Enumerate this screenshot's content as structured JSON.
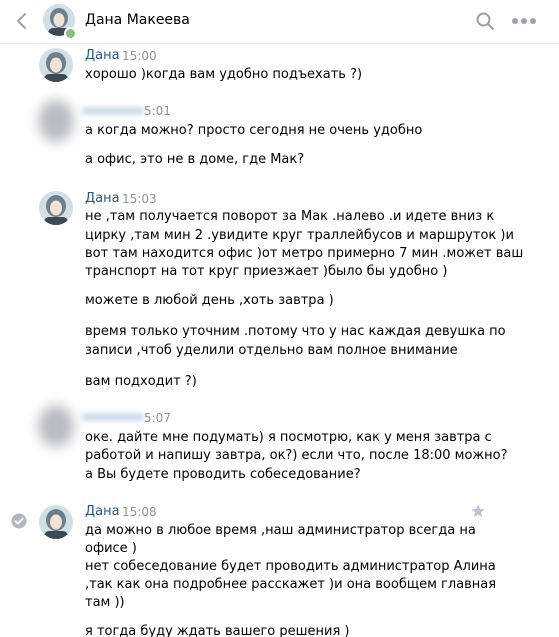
{
  "header": {
    "name": "Дана Макеева",
    "back_icon": "chevron-left-icon",
    "search_icon": "search-icon",
    "more_icon": "more-icon"
  },
  "messages": [
    {
      "author": "Дана",
      "time": "15:00",
      "lines": [
        "хорошо )когда вам удобно подъехать ?)"
      ]
    },
    {
      "author": "",
      "time": "5:01",
      "lines": [
        "а когда можно? просто сегодня не очень удобно",
        "а офис, это не в доме, где Мак?"
      ]
    },
    {
      "author": "Дана",
      "time": "15:03",
      "lines": [
        "не ,там получается поворот за Мак .налево .и идете вниз к",
        "цирку ,там мин 2 .увидите круг траллейбусов и маршруток )и",
        "вот там находится офис )от метро примерно 7 мин .может ваш",
        "транспорт на тот круг приезжает )было бы удобно )",
        "можете в любой день ,хоть завтра )",
        "время только уточним .потому что у нас каждая девушка по",
        "записи ,чтоб уделили отдельно вам полное внимание",
        "вам подходит ?)"
      ]
    },
    {
      "author": "",
      "time": "5:07",
      "lines": [
        "оке. дайте мне подумать) я посмотрю, как у меня завтра с",
        "работой и напишу завтра, ок?) если что, после 18:00 можно?",
        "а Вы будете проводить собеседование?"
      ]
    },
    {
      "author": "Дана",
      "time": "15:08",
      "lines": [
        "да можно в любое время ,наш администратор всегда на",
        "офисе )",
        "нет собеседование будет проводить администратор Алина",
        ",так как она подробнее расскажет )и она вообщем главная",
        "там ))",
        "я тогда буду ждать вашего решения )"
      ]
    }
  ],
  "colors": {
    "author": "#2a5885",
    "time": "#939393",
    "online": "#8ac176",
    "icons": "#99a2ad"
  }
}
